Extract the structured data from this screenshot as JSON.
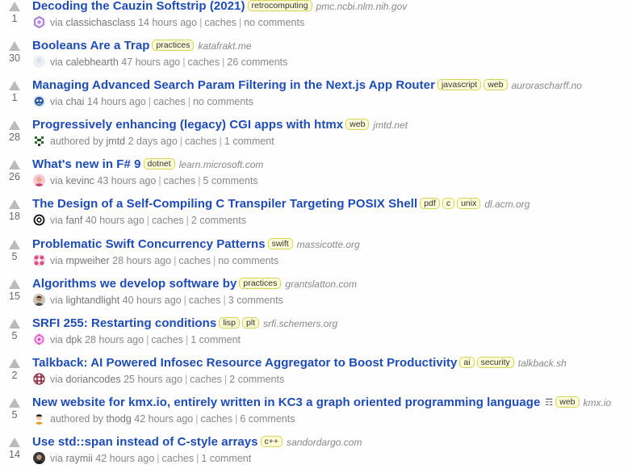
{
  "stories": [
    {
      "score": "1",
      "title": "Decoding the Cauzin Softstrip (2021)",
      "tags": [
        "retrocomputing"
      ],
      "domain": "pmc.ncbi.nlm.nih.gov",
      "verb": "via",
      "user": "classichasclass",
      "time": "14 hours ago",
      "caches": "caches",
      "comments": "no comments",
      "avatar": "purple-hex-icon",
      "has_description": false
    },
    {
      "score": "30",
      "title": "Booleans Are a Trap",
      "tags": [
        "practices"
      ],
      "domain": "katafrakt.me",
      "verb": "via",
      "user": "calebhearth",
      "time": "47 hours ago",
      "caches": "caches",
      "comments": "26 comments",
      "avatar": "blank-avatar-icon",
      "has_description": false
    },
    {
      "score": "1",
      "title": "Managing Advanced Search Param Filtering in the Next.js App Router",
      "tags": [
        "javascript",
        "web"
      ],
      "domain": "aurorascharff.no",
      "verb": "via",
      "user": "chai",
      "time": "14 hours ago",
      "caches": "caches",
      "comments": "no comments",
      "avatar": "blue-robot-icon",
      "has_description": false
    },
    {
      "score": "28",
      "title": "Progressively enhancing (legacy) CGI apps with htmx",
      "tags": [
        "web"
      ],
      "domain": "jmtd.net",
      "verb": "authored by",
      "user": "jmtd",
      "time": "2 days ago",
      "caches": "caches",
      "comments": "1 comment",
      "avatar": "green-pixel-icon",
      "has_description": false
    },
    {
      "score": "26",
      "title": "What's new in F# 9",
      "tags": [
        "dotnet"
      ],
      "domain": "learn.microsoft.com",
      "verb": "via",
      "user": "kevinc",
      "time": "43 hours ago",
      "caches": "caches",
      "comments": "5 comments",
      "avatar": "portrait-pink-icon",
      "has_description": false
    },
    {
      "score": "18",
      "title": "The Design of a Self-Compiling C Transpiler Targeting POSIX Shell",
      "tags": [
        "pdf",
        "c",
        "unix"
      ],
      "domain": "dl.acm.org",
      "verb": "via",
      "user": "fanf",
      "time": "40 hours ago",
      "caches": "caches",
      "comments": "2 comments",
      "avatar": "at-sign-icon",
      "has_description": false
    },
    {
      "score": "5",
      "title": "Problematic Swift Concurrency Patterns",
      "tags": [
        "swift"
      ],
      "domain": "massicotte.org",
      "verb": "via",
      "user": "mpweiher",
      "time": "28 hours ago",
      "caches": "caches",
      "comments": "no comments",
      "avatar": "pink-pattern-icon",
      "has_description": false
    },
    {
      "score": "15",
      "title": "Algorithms we develop software by",
      "tags": [
        "practices"
      ],
      "domain": "grantslatton.com",
      "verb": "via",
      "user": "lightandlight",
      "time": "40 hours ago",
      "caches": "caches",
      "comments": "3 comments",
      "avatar": "portrait-man-icon",
      "has_description": false
    },
    {
      "score": "5",
      "title": "SRFI 255: Restarting conditions",
      "tags": [
        "lisp",
        "plt"
      ],
      "domain": "srfi.schemers.org",
      "verb": "via",
      "user": "dpk",
      "time": "28 hours ago",
      "caches": "caches",
      "comments": "1 comment",
      "avatar": "magenta-flower-icon",
      "has_description": false
    },
    {
      "score": "2",
      "title": "Talkback: AI Powered Infosec Resource Aggregator to Boost Productivity",
      "tags": [
        "ai",
        "security"
      ],
      "domain": "talkback.sh",
      "verb": "via",
      "user": "doriancodes",
      "time": "25 hours ago",
      "caches": "caches",
      "comments": "2 comments",
      "avatar": "maroon-grid-icon",
      "has_description": false
    },
    {
      "score": "5",
      "title": "New website for kmx.io, entirely written in KC3 a graph oriented programming language",
      "tags": [
        "web"
      ],
      "domain": "kmx.io",
      "verb": "authored by",
      "user": "thodg",
      "time": "42 hours ago",
      "caches": "caches",
      "comments": "6 comments",
      "avatar": "portrait-cartoon-icon",
      "has_description": true
    },
    {
      "score": "14",
      "title": "Use std::span instead of C-style arrays",
      "tags": [
        "c++"
      ],
      "domain": "sandordargo.com",
      "verb": "via",
      "user": "raymii",
      "time": "42 hours ago",
      "caches": "caches",
      "comments": "1 comment",
      "avatar": "portrait-dark-icon",
      "has_description": false
    }
  ],
  "colors": {
    "title_link": "#1e4cb8",
    "tag_background": "#fffcd7",
    "tag_border": "#d5d458",
    "meta_text": "#888888",
    "upvote_arrow": "#bbbbbb"
  },
  "labels": {
    "separator": "|",
    "description_icon": "☶"
  }
}
